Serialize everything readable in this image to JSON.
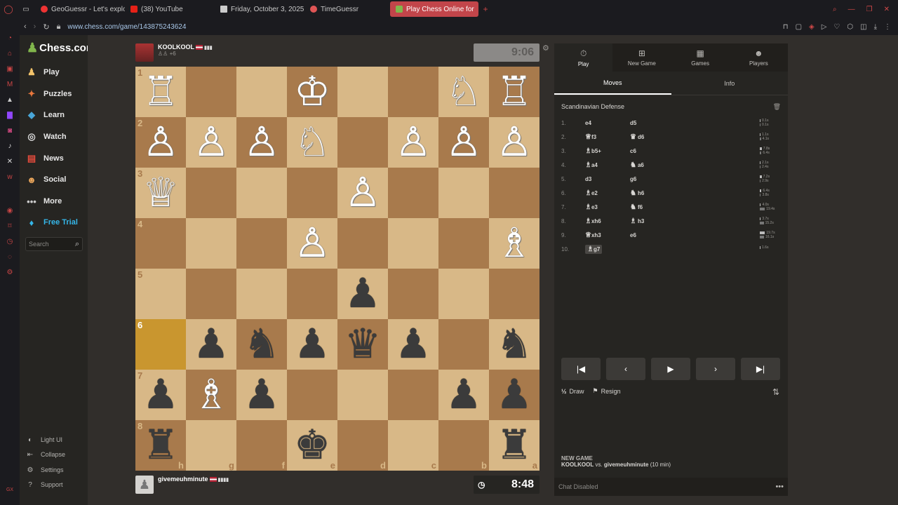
{
  "browser": {
    "tabs": [
      {
        "label": "GeoGuessr - Let's explore",
        "color": "#e0e0e0"
      },
      {
        "label": "(38) YouTube",
        "color": "#e62117"
      },
      {
        "label": "Friday, October 3, 2025",
        "color": "#ddd"
      },
      {
        "label": "TimeGuessr",
        "color": "#e05555"
      },
      {
        "label": "Play Chess Online for",
        "color": "#81b64c"
      }
    ],
    "new_tab": "+",
    "url": "www.chess.com/game/143875243624"
  },
  "sidebar": {
    "logo": "Chess.com",
    "items": [
      {
        "label": "Play",
        "icon": "play-icon"
      },
      {
        "label": "Puzzles",
        "icon": "puzzle-icon"
      },
      {
        "label": "Learn",
        "icon": "learn-icon"
      },
      {
        "label": "Watch",
        "icon": "watch-icon"
      },
      {
        "label": "News",
        "icon": "news-icon"
      },
      {
        "label": "Social",
        "icon": "social-icon"
      },
      {
        "label": "More",
        "icon": "more-icon"
      },
      {
        "label": "Free Trial",
        "icon": "diamond-icon"
      }
    ],
    "search_placeholder": "Search",
    "bottom": [
      {
        "label": "Light UI"
      },
      {
        "label": "Collapse"
      },
      {
        "label": "Settings"
      },
      {
        "label": "Support"
      }
    ]
  },
  "game": {
    "top_player": {
      "name": "KOOLKOOL",
      "sub": "+6",
      "clock": "9:06"
    },
    "bottom_player": {
      "name": "givemeuhminute",
      "clock": "8:48"
    },
    "board": [
      [
        {
          "p": "♖",
          "c": "w"
        },
        {
          "p": "",
          "c": ""
        },
        {
          "p": "",
          "c": ""
        },
        {
          "p": "♔",
          "c": "w"
        },
        {
          "p": "",
          "c": ""
        },
        {
          "p": "",
          "c": ""
        },
        {
          "p": "♘",
          "c": "w"
        },
        {
          "p": "♖",
          "c": "w"
        }
      ],
      [
        {
          "p": "♙",
          "c": "w"
        },
        {
          "p": "♙",
          "c": "w"
        },
        {
          "p": "♙",
          "c": "w"
        },
        {
          "p": "♘",
          "c": "w"
        },
        {
          "p": "",
          "c": ""
        },
        {
          "p": "♙",
          "c": "w"
        },
        {
          "p": "♙",
          "c": "w"
        },
        {
          "p": "♙",
          "c": "w"
        }
      ],
      [
        {
          "p": "♕",
          "c": "w"
        },
        {
          "p": "",
          "c": ""
        },
        {
          "p": "",
          "c": ""
        },
        {
          "p": "",
          "c": ""
        },
        {
          "p": "♙",
          "c": "w"
        },
        {
          "p": "",
          "c": ""
        },
        {
          "p": "",
          "c": ""
        },
        {
          "p": "",
          "c": ""
        }
      ],
      [
        {
          "p": "",
          "c": ""
        },
        {
          "p": "",
          "c": ""
        },
        {
          "p": "",
          "c": ""
        },
        {
          "p": "♙",
          "c": "w"
        },
        {
          "p": "",
          "c": ""
        },
        {
          "p": "",
          "c": ""
        },
        {
          "p": "",
          "c": ""
        },
        {
          "p": "♗",
          "c": "w"
        }
      ],
      [
        {
          "p": "",
          "c": ""
        },
        {
          "p": "",
          "c": ""
        },
        {
          "p": "",
          "c": ""
        },
        {
          "p": "",
          "c": ""
        },
        {
          "p": "♟",
          "c": "b"
        },
        {
          "p": "",
          "c": ""
        },
        {
          "p": "",
          "c": ""
        },
        {
          "p": "",
          "c": ""
        }
      ],
      [
        {
          "p": "",
          "c": ""
        },
        {
          "p": "♟",
          "c": "b"
        },
        {
          "p": "♞",
          "c": "b"
        },
        {
          "p": "♟",
          "c": "b"
        },
        {
          "p": "♛",
          "c": "b"
        },
        {
          "p": "♟",
          "c": "b"
        },
        {
          "p": "",
          "c": ""
        },
        {
          "p": "♞",
          "c": "b"
        }
      ],
      [
        {
          "p": "♟",
          "c": "b"
        },
        {
          "p": "♗",
          "c": "w"
        },
        {
          "p": "♟",
          "c": "b"
        },
        {
          "p": "",
          "c": ""
        },
        {
          "p": "",
          "c": ""
        },
        {
          "p": "",
          "c": ""
        },
        {
          "p": "♟",
          "c": "b"
        },
        {
          "p": "♟",
          "c": "b"
        }
      ],
      [
        {
          "p": "♜",
          "c": "b"
        },
        {
          "p": "",
          "c": ""
        },
        {
          "p": "",
          "c": ""
        },
        {
          "p": "♚",
          "c": "b"
        },
        {
          "p": "",
          "c": ""
        },
        {
          "p": "",
          "c": ""
        },
        {
          "p": "",
          "c": ""
        },
        {
          "p": "♜",
          "c": "b"
        }
      ]
    ],
    "ranks": [
      "1",
      "2",
      "3",
      "4",
      "5",
      "6",
      "7",
      "8"
    ],
    "files": [
      "h",
      "g",
      "f",
      "e",
      "d",
      "c",
      "b",
      "a"
    ],
    "highlight": [
      5,
      0
    ]
  },
  "panel": {
    "top_tabs": [
      {
        "label": "Play",
        "icon": "stopwatch-icon"
      },
      {
        "label": "New Game",
        "icon": "plus-icon"
      },
      {
        "label": "Games",
        "icon": "grid-icon"
      },
      {
        "label": "Players",
        "icon": "players-icon"
      }
    ],
    "sub_tabs": [
      "Moves",
      "Info"
    ],
    "opening": "Scandinavian Defense",
    "moves": [
      {
        "n": "1.",
        "w": "e4",
        "wp": "",
        "b": "d5",
        "bp": "",
        "t": [
          "0.1s",
          "0.1s"
        ],
        "f": [
          0.05,
          0.05
        ]
      },
      {
        "n": "2.",
        "w": "f3",
        "wp": "♕",
        "b": "d6",
        "bp": "♛",
        "t": [
          "1.1s",
          "4.1s"
        ],
        "f": [
          0.1,
          0.2
        ]
      },
      {
        "n": "3.",
        "w": "b5+",
        "wp": "♗",
        "b": "c6",
        "bp": "",
        "t": [
          "7.8s",
          "6.4s"
        ],
        "f": [
          0.35,
          0.3
        ]
      },
      {
        "n": "4.",
        "w": "a4",
        "wp": "♗",
        "b": "a6",
        "bp": "♞",
        "t": [
          "2.1s",
          "2.4s"
        ],
        "f": [
          0.1,
          0.12
        ]
      },
      {
        "n": "5.",
        "w": "d3",
        "wp": "",
        "b": "g6",
        "bp": "",
        "t": [
          "7.2s",
          "2.9s"
        ],
        "f": [
          0.33,
          0.14
        ]
      },
      {
        "n": "6.",
        "w": "e2",
        "wp": "♗",
        "b": "h6",
        "bp": "♞",
        "t": [
          "6.4s",
          "3.8s"
        ],
        "f": [
          0.3,
          0.18
        ]
      },
      {
        "n": "7.",
        "w": "e3",
        "wp": "♗",
        "b": "f6",
        "bp": "♞",
        "t": [
          "4.0s",
          "19.4s"
        ],
        "f": [
          0.18,
          0.9
        ]
      },
      {
        "n": "8.",
        "w": "xh6",
        "wp": "♗",
        "b": "h3",
        "bp": "♗",
        "t": [
          "3.7s",
          "15.2s"
        ],
        "f": [
          0.17,
          0.7
        ]
      },
      {
        "n": "9.",
        "w": "xh3",
        "wp": "♕",
        "b": "e6",
        "bp": "",
        "t": [
          "19.7s",
          "16.1s"
        ],
        "f": [
          0.92,
          0.75
        ]
      },
      {
        "n": "10.",
        "w": "g7",
        "wp": "♗",
        "b": "",
        "bp": "",
        "t": [
          "1.6s",
          ""
        ],
        "f": [
          0.07,
          0
        ]
      }
    ],
    "nav": [
      "⏮",
      "◀",
      "▶",
      "▶",
      "⏭"
    ],
    "draw_label": "Draw",
    "resign_label": "Resign",
    "new_game_title": "NEW GAME",
    "new_game_desc_p1": "KOOLKOOL",
    "new_game_vs": "vs.",
    "new_game_desc_p2": "givemeuhminute",
    "new_game_mode": "(10 min)",
    "chat_text": "Chat Disabled"
  }
}
